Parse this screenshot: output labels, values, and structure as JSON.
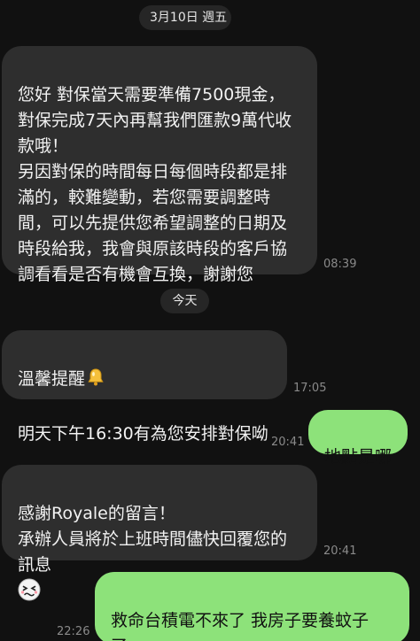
{
  "dividers": {
    "date_1": "3月10日 週五",
    "date_2": "今天"
  },
  "messages": [
    {
      "direction": "incoming",
      "text": "您好 對保當天需要準備7500現金，\n對保完成7天內再幫我們匯款9萬代收\n款哦！\n另因對保的時間每日每個時段都是排\n滿的，較難變動，若您需要調整時\n間，可以先提供您希望調整的日期及\n時段給我，我會與原該時段的客戶協\n調看看是否有機會互換，謝謝您",
      "time": "08:39"
    },
    {
      "direction": "incoming",
      "line1": "溫馨提醒",
      "line1_icon": "bell-emoji",
      "line2": "明天下午16:30有為您安排對保呦",
      "time": "17:05"
    },
    {
      "direction": "outgoing",
      "text": "地點是哪",
      "time": "20:41"
    },
    {
      "direction": "incoming",
      "text": "感謝Royale的留言！\n承辦人員將於上班時間儘快回覆您的\n訊息",
      "trailing_icon": "worried-face-sticker",
      "time": "20:41"
    },
    {
      "direction": "outgoing",
      "text": "救命台積電不來了 我房子要養蚊子\n了",
      "time": "22:26"
    }
  ],
  "colors": {
    "background": "#111111",
    "incoming_bubble": "#2e2e2e",
    "outgoing_bubble": "#8de27a",
    "timestamp": "#8a8a8a"
  }
}
